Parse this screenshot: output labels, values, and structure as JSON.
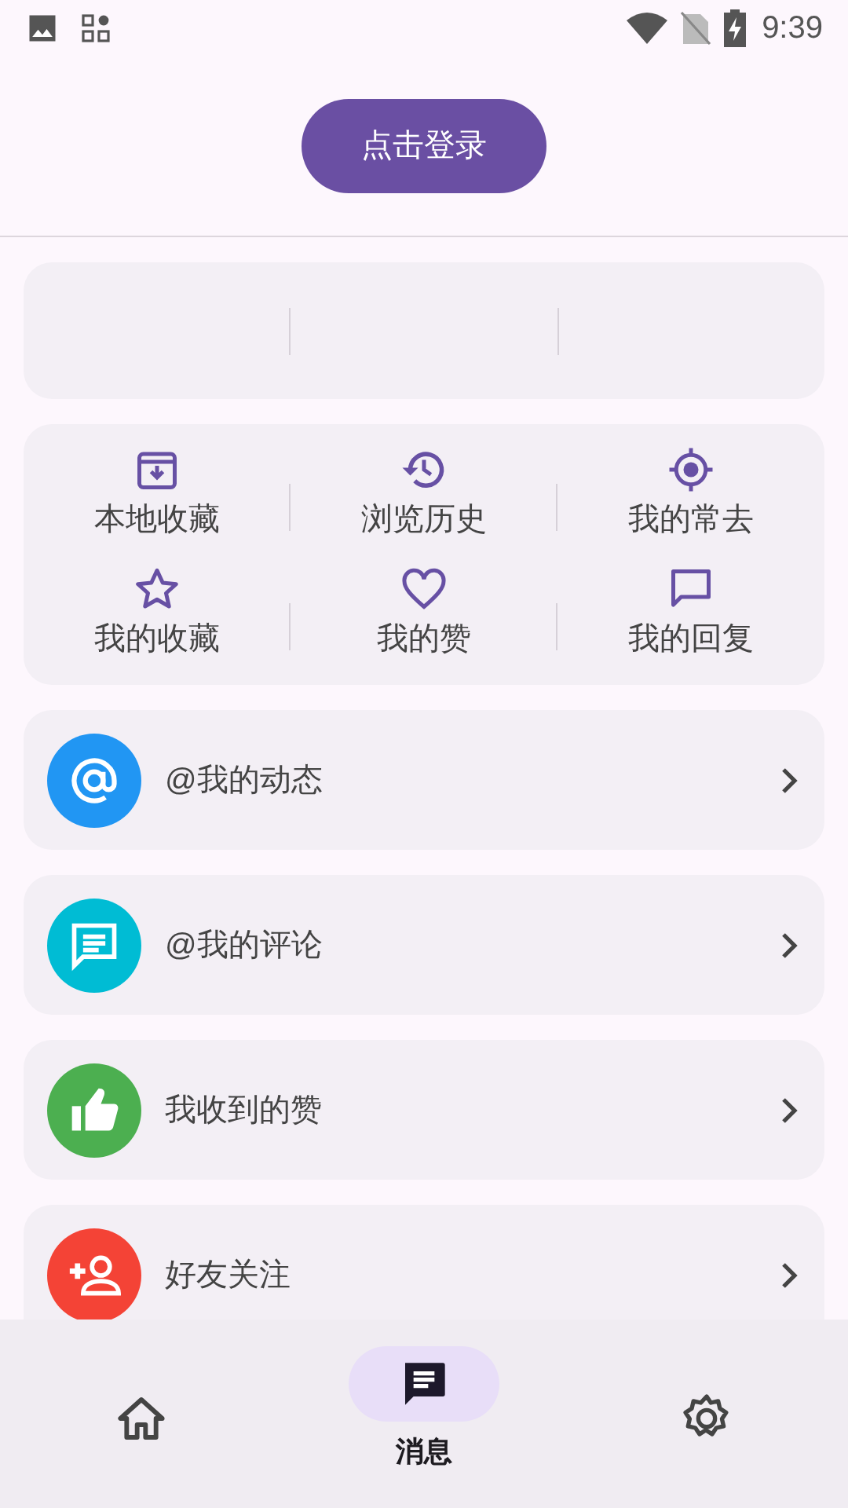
{
  "status_bar": {
    "time": "9:39"
  },
  "login_button": {
    "label": "点击登录"
  },
  "shortcuts": [
    {
      "label": "本地收藏",
      "kind": "archive"
    },
    {
      "label": "浏览历史",
      "kind": "history"
    },
    {
      "label": "我的常去",
      "kind": "location"
    },
    {
      "label": "我的收藏",
      "kind": "star"
    },
    {
      "label": "我的赞",
      "kind": "heart"
    },
    {
      "label": "我的回复",
      "kind": "comment"
    }
  ],
  "messages": [
    {
      "label": "@我的动态",
      "kind": "at",
      "color": "#2196f3"
    },
    {
      "label": "@我的评论",
      "kind": "comment",
      "color": "#00bcd4"
    },
    {
      "label": "我收到的赞",
      "kind": "like",
      "color": "#4caf50"
    },
    {
      "label": "好友关注",
      "kind": "follow",
      "color": "#f44336"
    }
  ],
  "bottom_nav": [
    {
      "kind": "home",
      "selected": false
    },
    {
      "kind": "messages",
      "label": "消息",
      "selected": true
    },
    {
      "kind": "settings",
      "selected": false
    }
  ]
}
